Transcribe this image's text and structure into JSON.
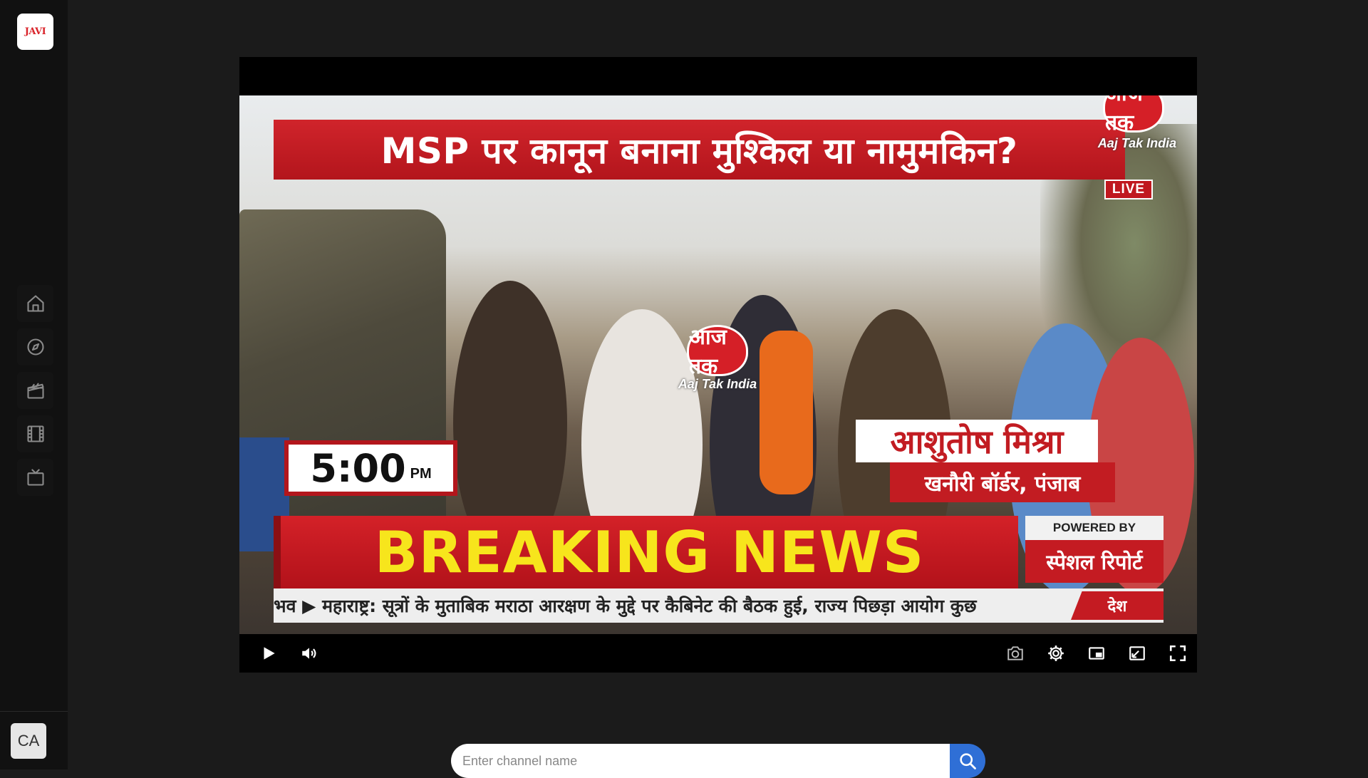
{
  "app": {
    "logo_text": "JAVI",
    "avatar_initials": "CA"
  },
  "sidebar": {
    "items": [
      {
        "name": "home",
        "icon": "home-icon"
      },
      {
        "name": "explore",
        "icon": "compass-icon"
      },
      {
        "name": "movies",
        "icon": "clapperboard-icon"
      },
      {
        "name": "films",
        "icon": "film-icon"
      },
      {
        "name": "tv",
        "icon": "tv-icon"
      }
    ]
  },
  "video": {
    "headline": "MSP पर कानून बनाना मुश्किल या नामुमकिन?",
    "channel_logo_text": "आज तक",
    "watermark_top": "Aaj Tak India",
    "watermark_center": "Aaj Tak India",
    "live_badge": "LIVE",
    "time": "5:00",
    "time_suffix": "PM",
    "reporter_name": "आशुतोष मिश्रा",
    "reporter_location": "खनौरी बॉर्डर, पंजाब",
    "breaking": "BREAKING NEWS",
    "powered_by": "POWERED BY",
    "special_report": "स्पेशल रिपोर्ट",
    "ticker": "भव  ▶ महाराष्ट्र: सूत्रों के मुताबिक मराठा आरक्षण के मुद्दे पर कैबिनेट की बैठक हुई, राज्य पिछड़ा आयोग कुछ",
    "ticker_tag": "देश"
  },
  "controls": {
    "play": "play-icon",
    "volume": "volume-icon",
    "snapshot": "camera-icon",
    "settings": "gear-icon",
    "pip": "picture-in-picture-icon",
    "resize": "resize-icon",
    "fullscreen": "fullscreen-icon"
  },
  "search": {
    "placeholder": "Enter channel name",
    "value": ""
  },
  "colors": {
    "background": "#1b1b1b",
    "sidebar": "#111111",
    "accent": "#2f6fd6",
    "news_red": "#c41b22",
    "breaking_yellow": "#f7e51c"
  }
}
